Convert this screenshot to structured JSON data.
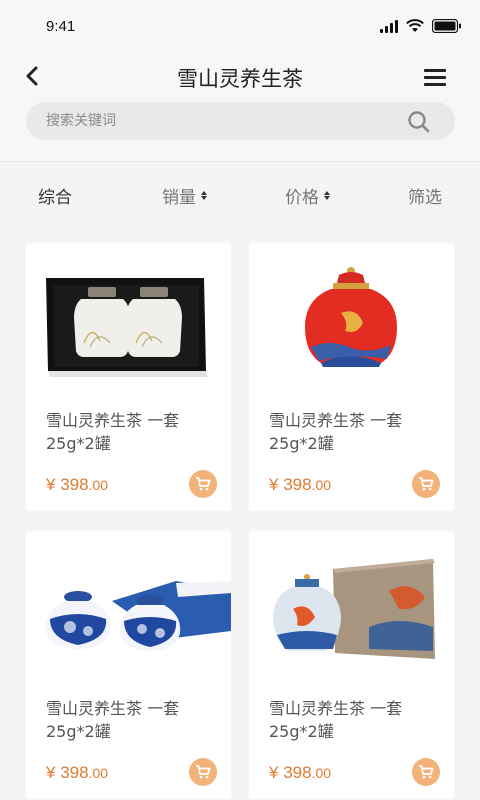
{
  "status_bar": {
    "time": "9:41"
  },
  "header": {
    "title": "雪山灵养生茶"
  },
  "search": {
    "placeholder": "搜索关键词",
    "value": ""
  },
  "sort_bar": {
    "items": [
      {
        "label": "综合",
        "has_arrows": false,
        "active": true
      },
      {
        "label": "销量",
        "has_arrows": true,
        "active": false
      },
      {
        "label": "价格",
        "has_arrows": true,
        "active": false
      },
      {
        "label": "筛选",
        "has_arrows": false,
        "active": false
      }
    ]
  },
  "products": [
    {
      "name": "雪山灵养生茶 一套25g*2罐",
      "price_symbol": "¥",
      "price_int": "398",
      "price_dec": ".00",
      "image": "white-jars-gift-box"
    },
    {
      "name": "雪山灵养生茶 一套25g*2罐",
      "price_symbol": "¥",
      "price_int": "398",
      "price_dec": ".00",
      "image": "red-koi-jar"
    },
    {
      "name": "雪山灵养生茶 一套25g*2罐",
      "price_symbol": "¥",
      "price_int": "398",
      "price_dec": ".00",
      "image": "blue-white-porcelain-jars"
    },
    {
      "name": "雪山灵养生茶 一套25g*2罐",
      "price_symbol": "¥",
      "price_int": "398",
      "price_dec": ".00",
      "image": "koi-jar-gift-box"
    }
  ],
  "colors": {
    "accent": "#e07a2e",
    "cart_button": "#f2b27a",
    "background": "#f4f4f4"
  }
}
